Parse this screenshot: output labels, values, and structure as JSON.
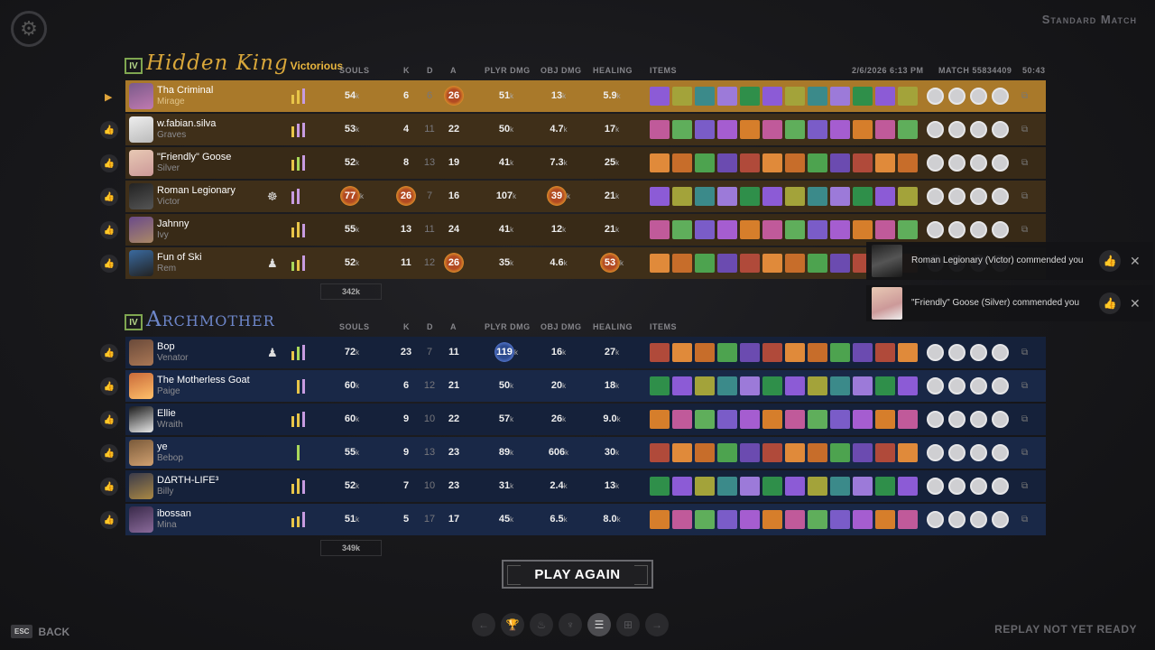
{
  "mode_label": "Standard Match",
  "match_info": {
    "date": "2/6/2026 6:13 PM",
    "match_id": "MATCH 55834409",
    "duration": "50:43"
  },
  "columns": {
    "souls": "SOULS",
    "k": "K",
    "d": "D",
    "a": "A",
    "player_damage": "PLYR DMG",
    "objective_damage": "OBJ DMG",
    "healing": "HEALING",
    "items": "ITEMS"
  },
  "unit_suffix": "k",
  "team1": {
    "rank": "IV",
    "name": "Hidden King",
    "result": "Victorious",
    "total_souls": "342k",
    "players": [
      {
        "name": "Tha Criminal",
        "hero": "Mirage",
        "souls": "54",
        "k": "6",
        "d": "6",
        "a": "26",
        "pdmg": "51",
        "odmg": "13",
        "heal": "5.9"
      },
      {
        "name": "w.fabian.silva",
        "hero": "Graves",
        "souls": "53",
        "k": "4",
        "d": "11",
        "a": "22",
        "pdmg": "50",
        "odmg": "4.7",
        "heal": "17"
      },
      {
        "name": "\"Friendly\" Goose",
        "hero": "Silver",
        "souls": "52",
        "k": "8",
        "d": "13",
        "a": "19",
        "pdmg": "41",
        "odmg": "7.3",
        "heal": "25"
      },
      {
        "name": "Roman Legionary",
        "hero": "Victor",
        "souls": "77",
        "k": "26",
        "d": "7",
        "a": "16",
        "pdmg": "107",
        "odmg": "39",
        "heal": "21"
      },
      {
        "name": "Jahnny",
        "hero": "Ivy",
        "souls": "55",
        "k": "13",
        "d": "11",
        "a": "24",
        "pdmg": "41",
        "odmg": "12",
        "heal": "21"
      },
      {
        "name": "Fun of Ski",
        "hero": "Rem",
        "souls": "52",
        "k": "11",
        "d": "12",
        "a": "26",
        "pdmg": "35",
        "odmg": "4.6",
        "heal": "53"
      }
    ]
  },
  "team2": {
    "rank": "IV",
    "name": "Archmother",
    "total_souls": "349k",
    "players": [
      {
        "name": "Bop",
        "hero": "Venator",
        "souls": "72",
        "k": "23",
        "d": "7",
        "a": "11",
        "pdmg": "119",
        "odmg": "16",
        "heal": "27"
      },
      {
        "name": "The Motherless Goat",
        "hero": "Paige",
        "souls": "60",
        "k": "6",
        "d": "12",
        "a": "21",
        "pdmg": "50",
        "odmg": "20",
        "heal": "18"
      },
      {
        "name": "Ellie",
        "hero": "Wraith",
        "souls": "60",
        "k": "9",
        "d": "10",
        "a": "22",
        "pdmg": "57",
        "odmg": "26",
        "heal": "9.0"
      },
      {
        "name": "ye",
        "hero": "Bebop",
        "souls": "55",
        "k": "9",
        "d": "13",
        "a": "23",
        "pdmg": "89",
        "odmg": "606",
        "heal": "30"
      },
      {
        "name": "DΔRTH-LIFE³",
        "hero": "Billy",
        "souls": "52",
        "k": "7",
        "d": "10",
        "a": "23",
        "pdmg": "31",
        "odmg": "2.4",
        "heal": "13"
      },
      {
        "name": "ibossan",
        "hero": "Mina",
        "souls": "51",
        "k": "5",
        "d": "17",
        "a": "17",
        "pdmg": "45",
        "odmg": "6.5",
        "heal": "8.0"
      }
    ]
  },
  "notifications": [
    {
      "message": "Roman Legionary (Victor) commended you"
    },
    {
      "message": "\"Friendly\" Goose (Silver) commended you"
    }
  ],
  "play_again_label": "PLAY AGAIN",
  "back": {
    "key": "ESC",
    "label": "BACK"
  },
  "replay_status": "REPLAY NOT YET READY",
  "colors": {
    "team1_accent": "#d8a63a",
    "team2_accent": "#6d86c9",
    "selected_row": "#a9792a"
  }
}
